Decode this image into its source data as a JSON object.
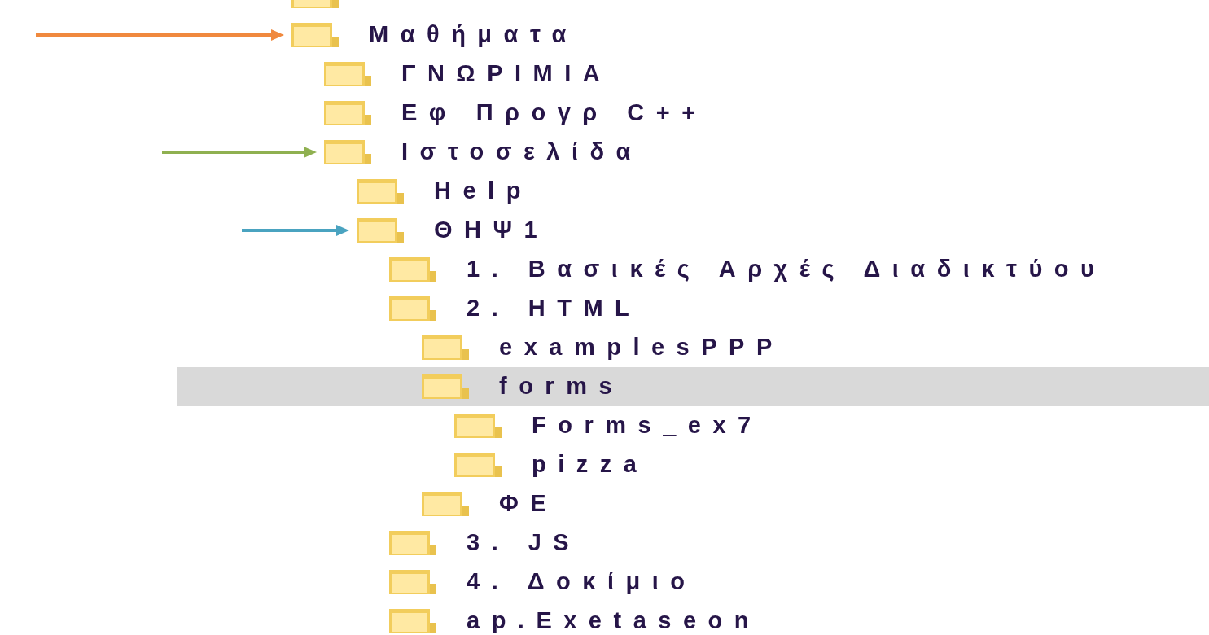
{
  "tree": [
    {
      "kind": "folder"
    },
    {
      "kind": "folder",
      "label": "Μαθήματα",
      "selected": false,
      "color": "#f0893e",
      "children": [
        {
          "kind": "folder",
          "label": "ΓΝΩΡΙΜΙΑ",
          "selected": false
        },
        {
          "kind": "folder",
          "label": "Εφ Προγρ C++",
          "selected": false
        },
        {
          "kind": "folder",
          "label": "Ιστοσελίδα",
          "selected": false,
          "color": "#8fb050",
          "children": [
            {
              "kind": "folder",
              "label": "Help",
              "selected": false
            },
            {
              "kind": "folder",
              "label": "ΘΗΨ1",
              "selected": false,
              "color": "#4aa3c0",
              "children": [
                {
                  "kind": "folder",
                  "label": "1. Βασικές Αρχές Διαδικτύου",
                  "selected": false
                },
                {
                  "kind": "folder",
                  "label": "2. HTML",
                  "selected": false,
                  "children": [
                    {
                      "kind": "folder",
                      "label": "examplesPPP",
                      "selected": false
                    },
                    {
                      "kind": "folder",
                      "label": "forms",
                      "selected": true,
                      "children": [
                        {
                          "kind": "folder",
                          "label": "Forms_ex7",
                          "selected": false
                        },
                        {
                          "kind": "folder",
                          "label": "pizza",
                          "selected": false
                        }
                      ]
                    },
                    {
                      "kind": "folder",
                      "label": "ΦΕ",
                      "selected": false
                    }
                  ]
                },
                {
                  "kind": "folder",
                  "label": "3. JS",
                  "selected": false
                },
                {
                  "kind": "folder",
                  "label": "4. Δοκίμιο",
                  "selected": false
                },
                {
                  "kind": "folder",
                  "label": "ap.Exetaseon",
                  "selected": false
                }
              ]
            }
          ]
        }
      ]
    }
  ]
}
